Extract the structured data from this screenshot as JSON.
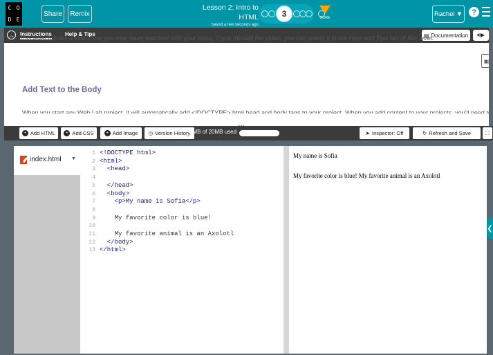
{
  "header": {
    "logo_letters": [
      "C",
      "O",
      "D",
      "E"
    ],
    "share_label": "Share",
    "remix_label": "Remix",
    "lesson_title": "Lesson 2: Intro to HTML",
    "saved_status": "Saved a few seconds ago",
    "current_level": "3",
    "more_label": "MORE",
    "user_name": "Rachel",
    "help_label": "?",
    "progress_accent": "#ffa400",
    "brand_color": "#0094a7"
  },
  "instructions": {
    "tabs": [
      {
        "label": "Instructions",
        "active": true
      },
      {
        "label": "Help & Tips",
        "active": false
      }
    ],
    "documentation_label": "Documentation",
    "body_text": "This level follows a video that you may have watched with your class. If you missed the video, you can watch it in the Help and Tips tab of this level.",
    "heading": "Add Text to the Body",
    "cut_off_text": "When you start any Web Lab project, it will automatically add <!DOCTYPE> html head and body tags to your project. When you add content to your projects, you'll need to"
  },
  "toolbar": {
    "add_html": "Add HTML",
    "add_css": "Add CSS",
    "add_image": "Add Image",
    "version_history": "Version History",
    "usage": "0MB of 20MB used",
    "inspector": "Inspector: Off",
    "refresh_save": "Refresh and Save"
  },
  "files": [
    {
      "name": "index.html"
    }
  ],
  "editor": {
    "lines": [
      {
        "n": "1",
        "text": "<!DOCTYPE html>",
        "plain": false
      },
      {
        "n": "2",
        "text": "<html>",
        "plain": false
      },
      {
        "n": "3",
        "text": "  <head>",
        "plain": false
      },
      {
        "n": "4",
        "text": "",
        "plain": false
      },
      {
        "n": "5",
        "text": "  </head>",
        "plain": false
      },
      {
        "n": "6",
        "text": "  <body>",
        "plain": false
      },
      {
        "n": "7",
        "text": "    <p>My name is Sofia</p>",
        "plain": false
      },
      {
        "n": "8",
        "text": "",
        "plain": false
      },
      {
        "n": "9",
        "text": "    My favorite color is blue!",
        "plain": true
      },
      {
        "n": "10",
        "text": "",
        "plain": false
      },
      {
        "n": "11",
        "text": "    My favorite animal is an Axolotl",
        "plain": true
      },
      {
        "n": "12",
        "text": "  </body>",
        "plain": false
      },
      {
        "n": "13",
        "text": "</html>",
        "plain": false
      }
    ]
  },
  "preview": {
    "line1": "My name is Sofia",
    "line2": "My favorite color is blue! My favorite animal is an Axolotl"
  }
}
